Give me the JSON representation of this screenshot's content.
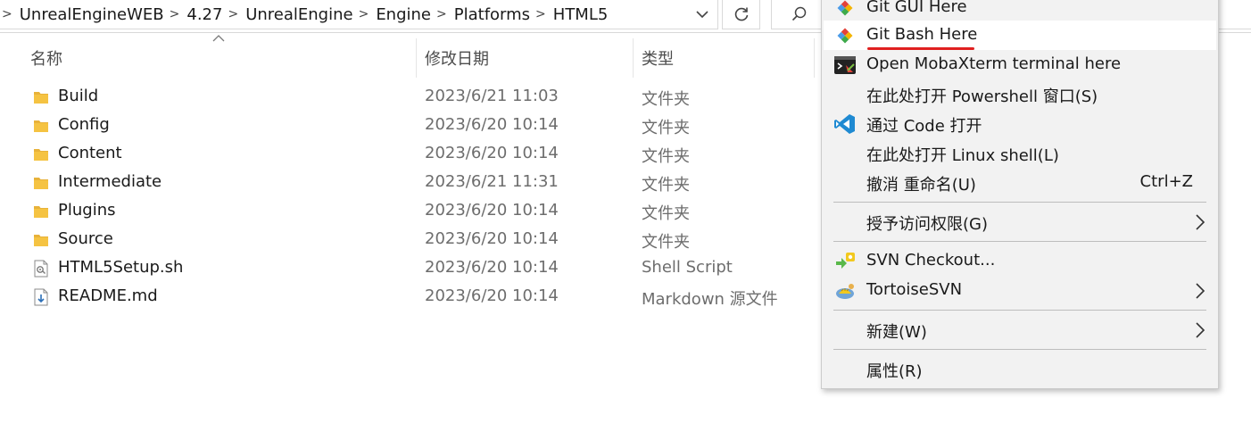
{
  "address_bar": {
    "crumbs": [
      "UnrealEngineWEB",
      "4.27",
      "UnrealEngine",
      "Engine",
      "Platforms",
      "HTML5"
    ]
  },
  "columns": {
    "name": "名称",
    "date": "修改日期",
    "type": "类型"
  },
  "files": [
    {
      "name": "Build",
      "date": "2023/6/21 11:03",
      "type": "文件夹",
      "icon": "folder-icon"
    },
    {
      "name": "Config",
      "date": "2023/6/20 10:14",
      "type": "文件夹",
      "icon": "folder-icon"
    },
    {
      "name": "Content",
      "date": "2023/6/20 10:14",
      "type": "文件夹",
      "icon": "folder-icon"
    },
    {
      "name": "Intermediate",
      "date": "2023/6/21 11:31",
      "type": "文件夹",
      "icon": "folder-icon"
    },
    {
      "name": "Plugins",
      "date": "2023/6/20 10:14",
      "type": "文件夹",
      "icon": "folder-icon"
    },
    {
      "name": "Source",
      "date": "2023/6/20 10:14",
      "type": "文件夹",
      "icon": "folder-icon"
    },
    {
      "name": "HTML5Setup.sh",
      "date": "2023/6/20 10:14",
      "type": "Shell Script",
      "icon": "shell-script-icon"
    },
    {
      "name": "README.md",
      "date": "2023/6/20 10:14",
      "type": "Markdown 源文件",
      "icon": "markdown-file-icon"
    }
  ],
  "context_menu": {
    "items": [
      {
        "label": "Git GUI Here",
        "icon": "git-icon"
      },
      {
        "label": "Git Bash Here",
        "icon": "git-icon",
        "highlighted": true
      },
      {
        "label": "Open MobaXterm terminal here",
        "icon": "mobaxterm-icon"
      },
      {
        "label": "在此处打开 Powershell 窗口(S)",
        "icon": ""
      },
      {
        "label": "通过 Code 打开",
        "icon": "vscode-icon"
      },
      {
        "label": "在此处打开 Linux shell(L)",
        "icon": ""
      },
      {
        "label": "撤消 重命名(U)",
        "shortcut": "Ctrl+Z",
        "icon": ""
      },
      {
        "label": "授予访问权限(G)",
        "submenu": true,
        "icon": ""
      },
      {
        "label": "SVN Checkout...",
        "icon": "svn-checkout-icon"
      },
      {
        "label": "TortoiseSVN",
        "submenu": true,
        "icon": "tortoisesvn-icon"
      },
      {
        "label": "新建(W)",
        "submenu": true,
        "icon": ""
      },
      {
        "label": "属性(R)",
        "icon": ""
      }
    ]
  },
  "colors": {
    "menu_bg": "#f2f2f2",
    "highlight_bg": "#ffffff",
    "annotation_underline": "#e02020",
    "folder": "#f5c342",
    "vscode": "#1f8ad2"
  }
}
